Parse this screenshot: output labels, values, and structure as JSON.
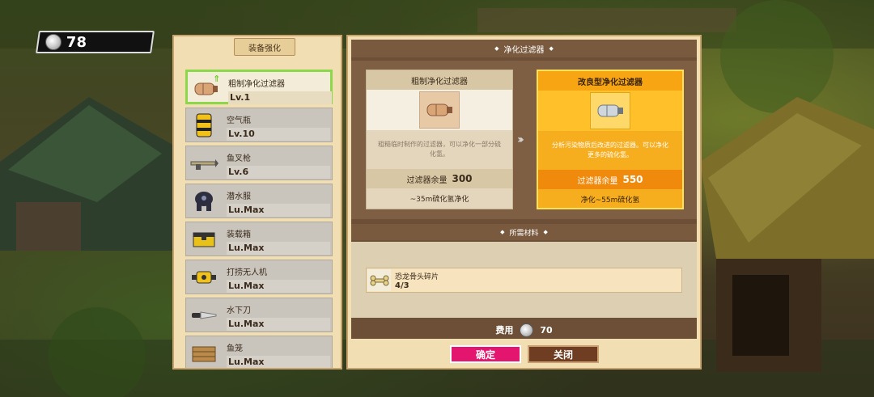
{
  "currency": {
    "amount": "78",
    "icon": "silver-coin-icon"
  },
  "left_panel": {
    "title": "装备强化",
    "items": [
      {
        "name": "粗制净化过滤器",
        "level": "Lv.1",
        "icon": "filter-canister-icon",
        "selected": true,
        "upgradeable": true
      },
      {
        "name": "空气瓶",
        "level": "Lv.10",
        "icon": "air-tank-icon"
      },
      {
        "name": "鱼叉枪",
        "level": "Lv.6",
        "icon": "harpoon-gun-icon"
      },
      {
        "name": "潜水服",
        "level": "Lu.Max",
        "icon": "diving-suit-icon"
      },
      {
        "name": "装载箱",
        "level": "Lu.Max",
        "icon": "cargo-box-icon"
      },
      {
        "name": "打捞无人机",
        "level": "Lu.Max",
        "icon": "salvage-drone-icon"
      },
      {
        "name": "水下刀",
        "level": "Lu.Max",
        "icon": "underwater-knife-icon"
      },
      {
        "name": "鱼笼",
        "level": "Lu.Max",
        "icon": "fish-trap-icon"
      }
    ]
  },
  "right_panel": {
    "header": "净化过滤器",
    "current": {
      "title": "粗制净化过滤器",
      "desc": "粗糙临时制作的过滤器，可以净化一部分硫化氢。",
      "capacity_label": "过滤器余量",
      "capacity_value": "300",
      "footer": "~35m硫化氢净化"
    },
    "next": {
      "title": "改良型净化过滤器",
      "desc": "分析污染物质后改进的过滤器。可以净化更多的硫化氢。",
      "capacity_label": "过滤器余量",
      "capacity_value": "550",
      "footer": "净化~55m硫化氢"
    },
    "arrow": "›››",
    "materials_header": "所需材料",
    "materials": [
      {
        "name": "恐龙骨头碎片",
        "qty": "4/3",
        "icon": "dinosaur-bone-icon"
      }
    ],
    "cost_label": "费用",
    "cost_value": "70",
    "confirm_label": "确定",
    "close_label": "关闭"
  },
  "colors": {
    "confirm": "#e3156f",
    "highlight": "#f6ad1e",
    "selected_border": "#8bd84a"
  }
}
